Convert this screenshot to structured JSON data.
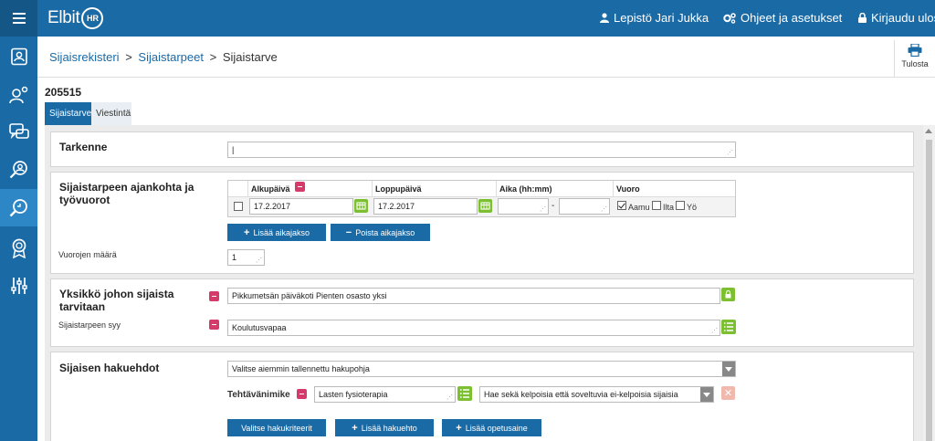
{
  "app": {
    "logo_text": "Elbit",
    "logo_badge": "HR"
  },
  "topbar": {
    "user_name": "Lepistö Jari Jukka",
    "settings_label": "Ohjeet ja asetukset",
    "logout_label": "Kirjaudu ulos"
  },
  "breadcrumb": {
    "item1": "Sijaisrekisteri",
    "item2": "Sijaistarpeet",
    "current": "Sijaistarve",
    "sep": ">"
  },
  "print": {
    "label": "Tulosta"
  },
  "record": {
    "id": "205515"
  },
  "tabs": [
    {
      "label": "Sijaistarve"
    },
    {
      "label": "Viestintä"
    }
  ],
  "tarkenne": {
    "title": "Tarkenne",
    "value": "|"
  },
  "timing": {
    "title": "Sijaistarpeen ajankohta ja työvuorot",
    "headers": {
      "start": "Alkupäivä",
      "end": "Loppupäivä",
      "time": "Aika (hh:mm)",
      "shift": "Vuoro"
    },
    "row": {
      "start_date": "17.2.2017",
      "end_date": "17.2.2017",
      "dash": "-"
    },
    "shifts": [
      {
        "label": "Aamu",
        "checked": true
      },
      {
        "label": "Ilta",
        "checked": false
      },
      {
        "label": "Yö",
        "checked": false
      }
    ],
    "add_button": "Lisää aikajakso",
    "remove_button": "Poista aikajakso",
    "count_label": "Vuorojen määrä",
    "count_value": "1"
  },
  "unit": {
    "title": "Yksikkö johon sijaista tarvitaan",
    "value": "Pikkumetsän päiväkoti Pienten osasto yksi",
    "reason_label": "Sijaistarpeen syy",
    "reason_value": "Koulutusvapaa"
  },
  "search": {
    "title": "Sijaisen hakuehdot",
    "template_select": "Valitse aiemmin tallennettu hakupohja",
    "title_label": "Tehtävänimike",
    "title_value": "Lasten fysioterapia",
    "eligibility_select": "Hae sekä kelpoisia että soveltuvia ei-kelpoisia sijaisia",
    "btn_criteria": "Valitse hakukriteerit",
    "btn_add_condition": "Lisää hakuehto",
    "btn_add_subject": "Lisää opetusaine"
  },
  "colors": {
    "header": "#1a6aa6",
    "accent_green": "#7cbf30",
    "required": "#d63a6a"
  }
}
